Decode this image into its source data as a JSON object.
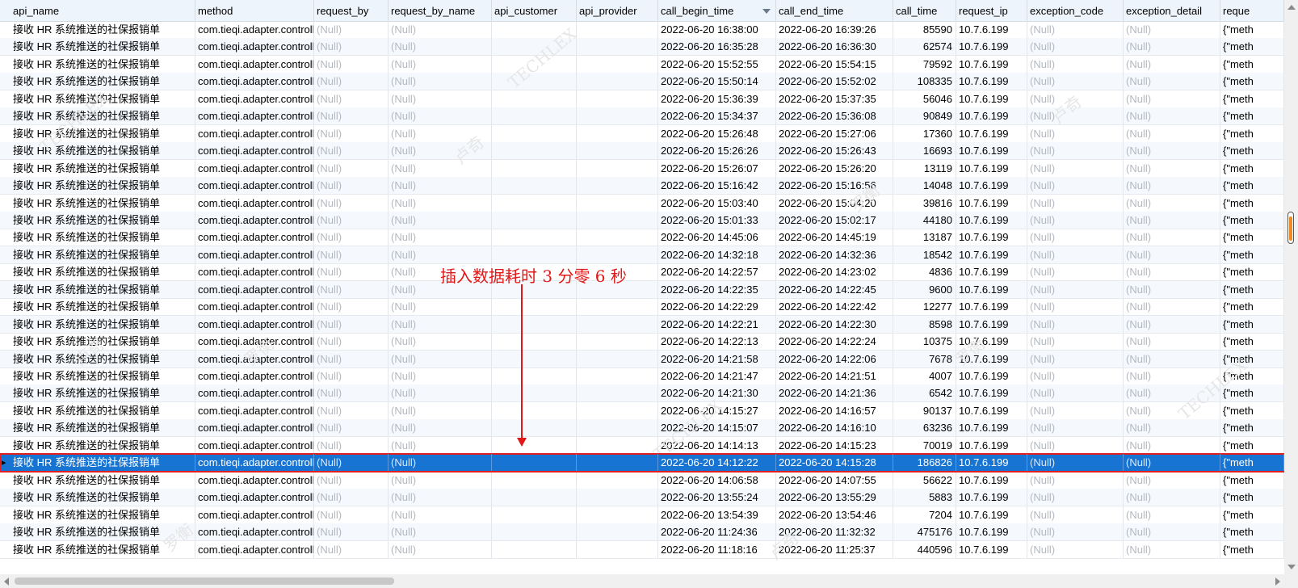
{
  "columns": [
    {
      "label": "api_name",
      "sorted": false
    },
    {
      "label": "method",
      "sorted": false
    },
    {
      "label": "request_by",
      "sorted": false
    },
    {
      "label": "request_by_name",
      "sorted": false
    },
    {
      "label": "api_customer",
      "sorted": false
    },
    {
      "label": "api_provider",
      "sorted": false
    },
    {
      "label": "call_begin_time",
      "sorted": true
    },
    {
      "label": "call_end_time",
      "sorted": false
    },
    {
      "label": "call_time",
      "sorted": false
    },
    {
      "label": "request_ip",
      "sorted": false
    },
    {
      "label": "exception_code",
      "sorted": false
    },
    {
      "label": "exception_detail",
      "sorted": false
    },
    {
      "label": "reque",
      "sorted": false
    }
  ],
  "constants": {
    "api_name": "接收 HR 系统推送的社保报销单",
    "method": "com.tieqi.adapter.controll",
    "null_text": "(Null)",
    "ip": "10.7.6.199",
    "reque": "{\"meth",
    "row_marker": "▸"
  },
  "rows": [
    {
      "begin": "2022-06-20 16:38:00",
      "end": "2022-06-20 16:39:26",
      "call_time": "85590"
    },
    {
      "begin": "2022-06-20 16:35:28",
      "end": "2022-06-20 16:36:30",
      "call_time": "62574"
    },
    {
      "begin": "2022-06-20 15:52:55",
      "end": "2022-06-20 15:54:15",
      "call_time": "79592"
    },
    {
      "begin": "2022-06-20 15:50:14",
      "end": "2022-06-20 15:52:02",
      "call_time": "108335"
    },
    {
      "begin": "2022-06-20 15:36:39",
      "end": "2022-06-20 15:37:35",
      "call_time": "56046"
    },
    {
      "begin": "2022-06-20 15:34:37",
      "end": "2022-06-20 15:36:08",
      "call_time": "90849"
    },
    {
      "begin": "2022-06-20 15:26:48",
      "end": "2022-06-20 15:27:06",
      "call_time": "17360"
    },
    {
      "begin": "2022-06-20 15:26:26",
      "end": "2022-06-20 15:26:43",
      "call_time": "16693"
    },
    {
      "begin": "2022-06-20 15:26:07",
      "end": "2022-06-20 15:26:20",
      "call_time": "13119"
    },
    {
      "begin": "2022-06-20 15:16:42",
      "end": "2022-06-20 15:16:56",
      "call_time": "14048"
    },
    {
      "begin": "2022-06-20 15:03:40",
      "end": "2022-06-20 15:04:20",
      "call_time": "39816"
    },
    {
      "begin": "2022-06-20 15:01:33",
      "end": "2022-06-20 15:02:17",
      "call_time": "44180"
    },
    {
      "begin": "2022-06-20 14:45:06",
      "end": "2022-06-20 14:45:19",
      "call_time": "13187"
    },
    {
      "begin": "2022-06-20 14:32:18",
      "end": "2022-06-20 14:32:36",
      "call_time": "18542"
    },
    {
      "begin": "2022-06-20 14:22:57",
      "end": "2022-06-20 14:23:02",
      "call_time": "4836"
    },
    {
      "begin": "2022-06-20 14:22:35",
      "end": "2022-06-20 14:22:45",
      "call_time": "9600"
    },
    {
      "begin": "2022-06-20 14:22:29",
      "end": "2022-06-20 14:22:42",
      "call_time": "12277"
    },
    {
      "begin": "2022-06-20 14:22:21",
      "end": "2022-06-20 14:22:30",
      "call_time": "8598"
    },
    {
      "begin": "2022-06-20 14:22:13",
      "end": "2022-06-20 14:22:24",
      "call_time": "10375"
    },
    {
      "begin": "2022-06-20 14:21:58",
      "end": "2022-06-20 14:22:06",
      "call_time": "7678"
    },
    {
      "begin": "2022-06-20 14:21:47",
      "end": "2022-06-20 14:21:51",
      "call_time": "4007"
    },
    {
      "begin": "2022-06-20 14:21:30",
      "end": "2022-06-20 14:21:36",
      "call_time": "6542"
    },
    {
      "begin": "2022-06-20 14:15:27",
      "end": "2022-06-20 14:16:57",
      "call_time": "90137"
    },
    {
      "begin": "2022-06-20 14:15:07",
      "end": "2022-06-20 14:16:10",
      "call_time": "63236"
    },
    {
      "begin": "2022-06-20 14:14:13",
      "end": "2022-06-20 14:15:23",
      "call_time": "70019"
    },
    {
      "begin": "2022-06-20 14:12:22",
      "end": "2022-06-20 14:15:28",
      "call_time": "186826",
      "selected": true
    },
    {
      "begin": "2022-06-20 14:06:58",
      "end": "2022-06-20 14:07:55",
      "call_time": "56622"
    },
    {
      "begin": "2022-06-20 13:55:24",
      "end": "2022-06-20 13:55:29",
      "call_time": "5883"
    },
    {
      "begin": "2022-06-20 13:54:39",
      "end": "2022-06-20 13:54:46",
      "call_time": "7204"
    },
    {
      "begin": "2022-06-20 11:24:36",
      "end": "2022-06-20 11:32:32",
      "call_time": "475176"
    },
    {
      "begin": "2022-06-20 11:18:16",
      "end": "2022-06-20 11:25:37",
      "call_time": "440596"
    }
  ],
  "annotation": {
    "text": "插入数据耗时 3 分零 6 秒",
    "color": "#e01818"
  },
  "watermark": {
    "texts": [
      "TECHLEX",
      "罗衡",
      "卢奇"
    ]
  },
  "colors": {
    "selected_row": "#1874d2",
    "highlight_border": "#e02020",
    "header_bg": "#eef4fb",
    "alt_row": "#f5f9fe",
    "null_text": "#b4b9bf",
    "scroll_thumb_accent": "#f08a24"
  }
}
